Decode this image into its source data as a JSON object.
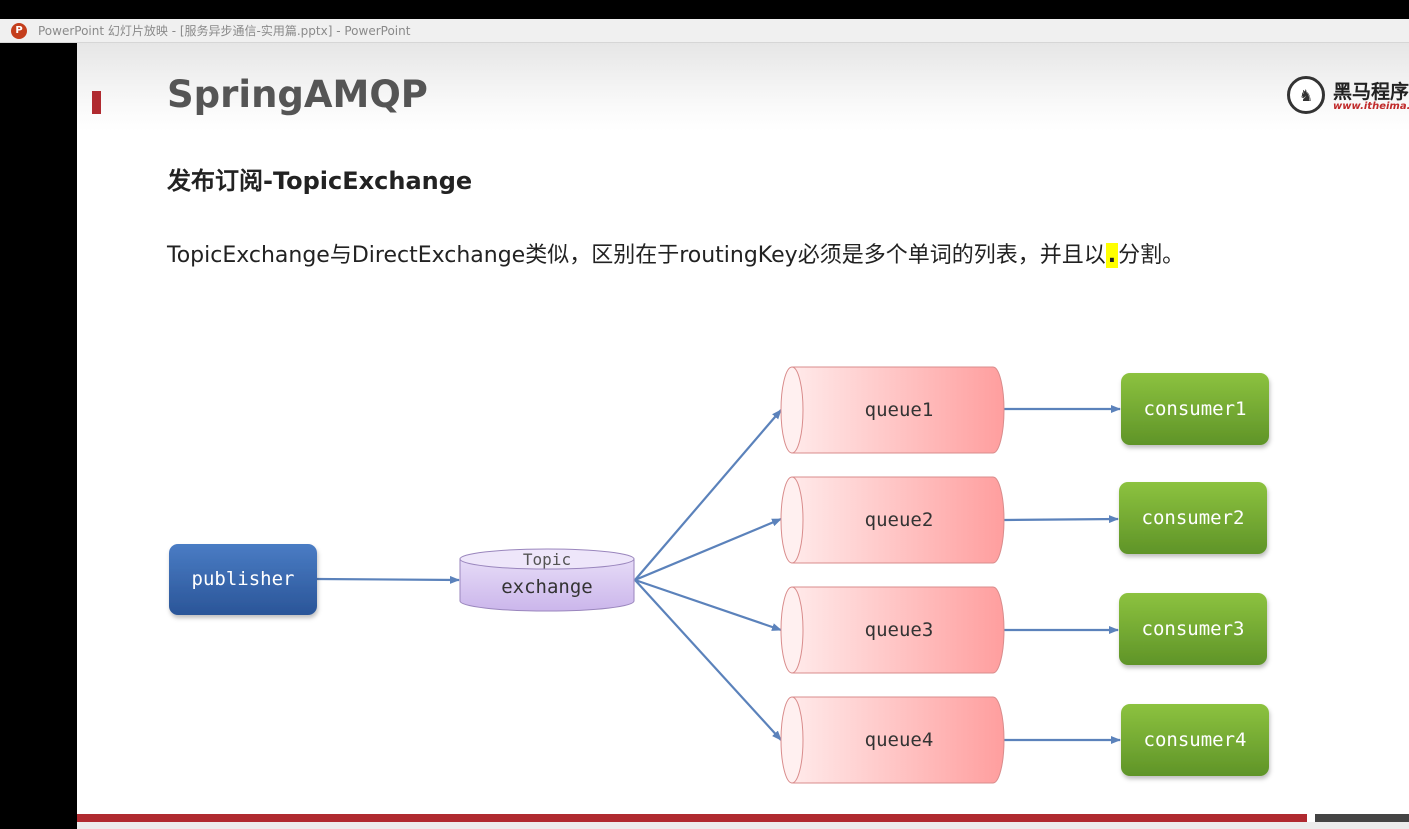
{
  "window": {
    "title": "PowerPoint 幻灯片放映 - [服务异步通信-实用篇.pptx] - PowerPoint",
    "icon": "powerpoint-icon"
  },
  "slide": {
    "title": "SpringAMQP",
    "subtitle": "发布订阅-TopicExchange",
    "desc_before": "TopicExchange与DirectExchange类似，区别在于routingKey必须是多个单词的列表，并且以",
    "desc_highlight": ".",
    "desc_after": "分割。",
    "logo": {
      "cn": "黑马程序",
      "url": "www.itheima.c"
    }
  },
  "diagram": {
    "publisher": "publisher",
    "exchange_top": "Topic",
    "exchange_label": "exchange",
    "queues": [
      "queue1",
      "queue2",
      "queue3",
      "queue4"
    ],
    "consumers": [
      "consumer1",
      "consumer2",
      "consumer3",
      "consumer4"
    ]
  },
  "colors": {
    "accent_red": "#b02a30",
    "publisher_blue": "#2e5fa8",
    "exchange_purple": "#d9c8f0",
    "queue_pink": "#ffb0b0",
    "consumer_green": "#72a832",
    "arrow_blue": "#5b82bb"
  }
}
